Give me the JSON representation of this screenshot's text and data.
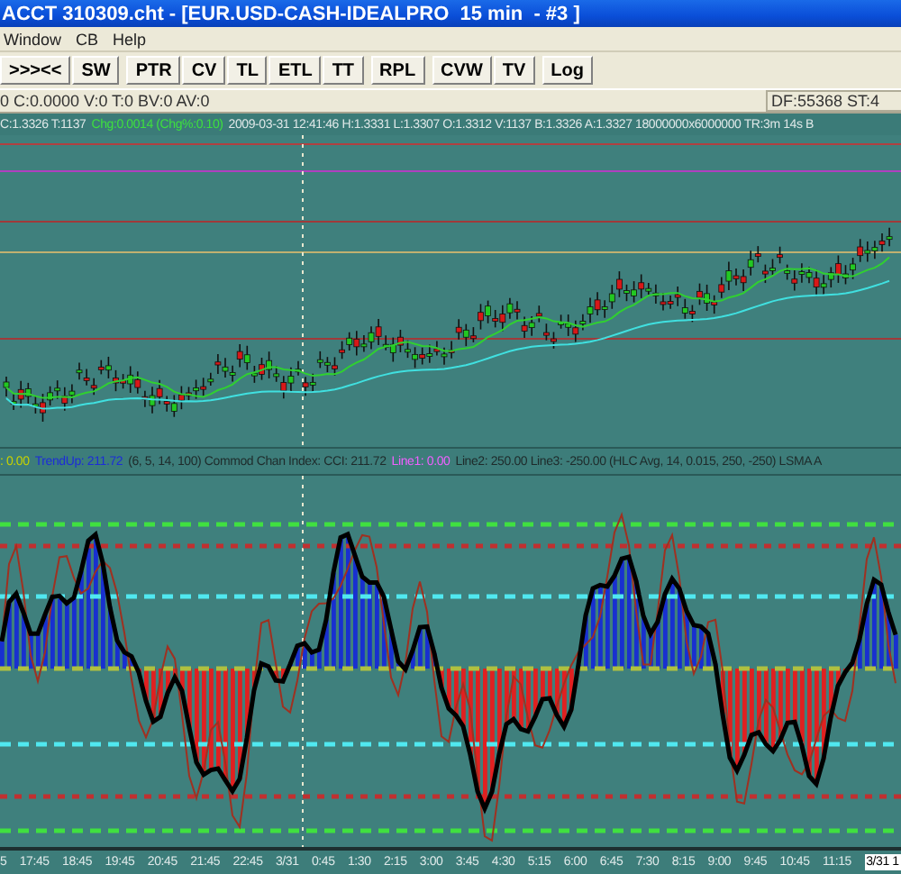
{
  "window": {
    "title": "ACCT 310309.cht - [EUR.USD-CASH-IDEALPRO  15 min  - #3 ]"
  },
  "menu": [
    "Window",
    "CB",
    "Help"
  ],
  "toolbar": [
    [
      ">>><<",
      "SW"
    ],
    [
      "PTR",
      "CV",
      "TL",
      "ETL",
      "TT"
    ],
    [
      "RPL"
    ],
    [
      "CVW",
      "TV"
    ],
    [
      "Log"
    ]
  ],
  "status_bar": {
    "left": "0 C:0.0000 V:0 T:0 BV:0 AV:0",
    "right": "DF:55368 ST:4"
  },
  "quote_bar": [
    {
      "text": "C:1.3326 T:1137",
      "kind": "plain"
    },
    {
      "text": "Chg:0.0014 (Chg%:0.10)",
      "kind": "change"
    },
    {
      "text": "2009-03-31 12:41:46 H:1.3331 L:1.3307 O:1.3312 V:1137 B:1.3326 A:1.3327 18000000x6000000 TR:3m 14s B",
      "kind": "plain"
    }
  ],
  "indicator_legend": [
    {
      "text": ": 0.00",
      "color": "#c8d200"
    },
    {
      "text": "TrendUp: 211.72",
      "color": "#1c2cd8"
    },
    {
      "text": "(6, 5, 14, 100) Commod Chan Index: CCI: 211.72",
      "color": "#1e2a2a"
    },
    {
      "text": "Line1: 0.00",
      "color": "#f060ff"
    },
    {
      "text": "Line2: 250.00 Line3: -250.00 (HLC Avg, 14, 0.015, 250, -250) LSMA A",
      "color": "#1e2a2a"
    }
  ],
  "time_axis": [
    "5",
    "17:45",
    "18:45",
    "19:45",
    "20:45",
    "21:45",
    "22:45",
    "3/31",
    "0:45",
    "1:30",
    "2:15",
    "3:00",
    "3:45",
    "4:30",
    "5:15",
    "6:00",
    "6:45",
    "7:30",
    "8:15",
    "9:00",
    "9:45",
    "10:45",
    "11:15"
  ],
  "time_axis_current": "3/31 1"
}
